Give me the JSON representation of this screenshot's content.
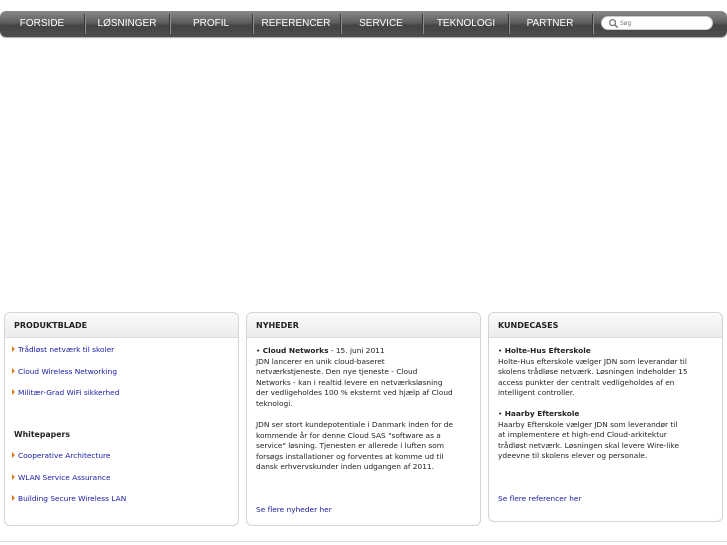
{
  "nav": {
    "items": [
      "FORSIDE",
      "LØSNINGER",
      "PROFIL",
      "REFERENCER",
      "SERVICE",
      "TEKNOLOGI",
      "PARTNER"
    ],
    "search_placeholder": "Søg"
  },
  "produktblade": {
    "title": "PRODUKTBLADE",
    "links": [
      "Trådløst netværk til skoler",
      "Cloud Wireless Networking",
      "Militær-Grad WiFi sikkerhed"
    ],
    "whitepapers_heading": "Whitepapers",
    "whitepapers": [
      "Cooperative Architecture",
      "WLAN Service Assurance",
      "Building Secure Wireless LAN"
    ]
  },
  "nyheder": {
    "title": "NYHEDER",
    "item1_title": "Cloud Networks",
    "item1_date": " - 15. juni 2011",
    "item1_lines": [
      "JDN lancerer en unik cloud-baseret",
      "netværkstjeneste. Den nye tjeneste - Cloud",
      "Networks - kan i realtid levere en netværksløsning",
      "der vedligeholdes 100 % eksternt ved hjælp af Cloud",
      "teknologi."
    ],
    "item2_lines": [
      "JDN ser stort kundepotentiale i Danmark inden for de",
      "kommende år for denne Cloud SAS \"software as a",
      "service\" løsning. Tjenesten er allerede i luften som",
      "forsøgs installationer og forventes at komme ud til",
      "dansk erhvervskunder inden udgangen af 2011."
    ],
    "more": "Se flere nyheder her"
  },
  "kundecases": {
    "title": "KUNDECASES",
    "case1_title": "Holte-Hus Efterskole",
    "case1_lines": [
      "Holte-Hus efterskole vælger JDN som leverandør til",
      "skolens trådløse netværk. Løsningen indeholder 15",
      "access punkter der centralt vedligeholdes af en",
      "intelligent controller."
    ],
    "case2_title": "Haarby Efterskole",
    "case2_lines": [
      "Haarby Efterskole vælger JDN som leverandør til",
      "at implementere et high-end Cloud-arkitektur",
      "trådløst netværk. Løsningen skal levere Wire-like",
      "ydeevne til skolens elever og personale."
    ],
    "more": "Se flere referencer her"
  }
}
